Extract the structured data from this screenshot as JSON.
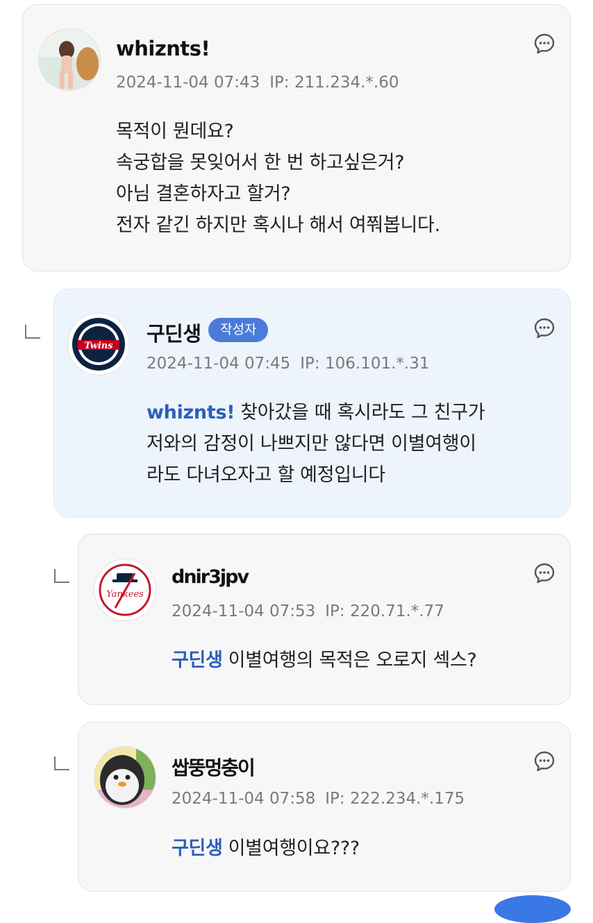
{
  "comments": [
    {
      "username": "whiznts!",
      "date": "2024-11-04 07:43",
      "ip": "IP: 211.234.*.60",
      "avatar_icon": "user-photo-avatar",
      "lines": [
        "목적이 뭔데요?",
        "속궁합을 못잊어서 한 번 하고싶은거?",
        "아님 결혼하자고 할거?",
        "전자 같긴 하지만 혹시나 해서 여쭤봅니다."
      ]
    },
    {
      "username": "구딘생",
      "badge": "작성자",
      "date": "2024-11-04 07:45",
      "ip": "IP: 106.101.*.31",
      "avatar_icon": "twins-logo-avatar",
      "mention": "whiznts!",
      "lines": [
        "찾아갔을 때 혹시라도 그 친구가",
        "저와의 감정이 나쁘지만 않다면 이별여행이",
        "라도 다녀오자고 할 예정입니다"
      ]
    },
    {
      "username": "dnir3jpv",
      "date": "2024-11-04 07:53",
      "ip": "IP: 220.71.*.77",
      "avatar_icon": "yankees-logo-avatar",
      "mention": "구딘생",
      "lines": [
        "이별여행의 목적은 오로지 섹스?"
      ]
    },
    {
      "username": "쌉뚱멍충이",
      "date": "2024-11-04 07:58",
      "ip": "IP: 222.234.*.175",
      "avatar_icon": "penguin-avatar",
      "mention": "구딘생",
      "lines": [
        "이별여행이요???"
      ]
    }
  ],
  "icons": {
    "comment": "speech-bubble-icon",
    "reply_indicator": "reply-corner-icon"
  },
  "colors": {
    "mention": "#2d5fb8",
    "author_badge": "#4b7bd9",
    "author_card_bg": "#eef4fc",
    "card_bg": "#f7f7f8",
    "meta_text": "#7a7a7a"
  }
}
